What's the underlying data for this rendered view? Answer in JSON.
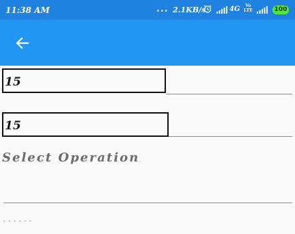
{
  "status_bar": {
    "time": "11:38 AM",
    "dots": "...",
    "speed": "2.1KB/s",
    "network": "4G",
    "volte_top": "Vo",
    "volte_bottom": "LTE",
    "battery": "100",
    "icons": [
      "alarm-icon",
      "signal-icon",
      "signal-icon"
    ]
  },
  "app_bar": {
    "back_icon": "arrow-left-icon",
    "color": "#2196f3"
  },
  "form": {
    "number1": {
      "value": "15"
    },
    "number2": {
      "value": "15"
    },
    "operation_label": "Select Operation",
    "result": "------"
  }
}
